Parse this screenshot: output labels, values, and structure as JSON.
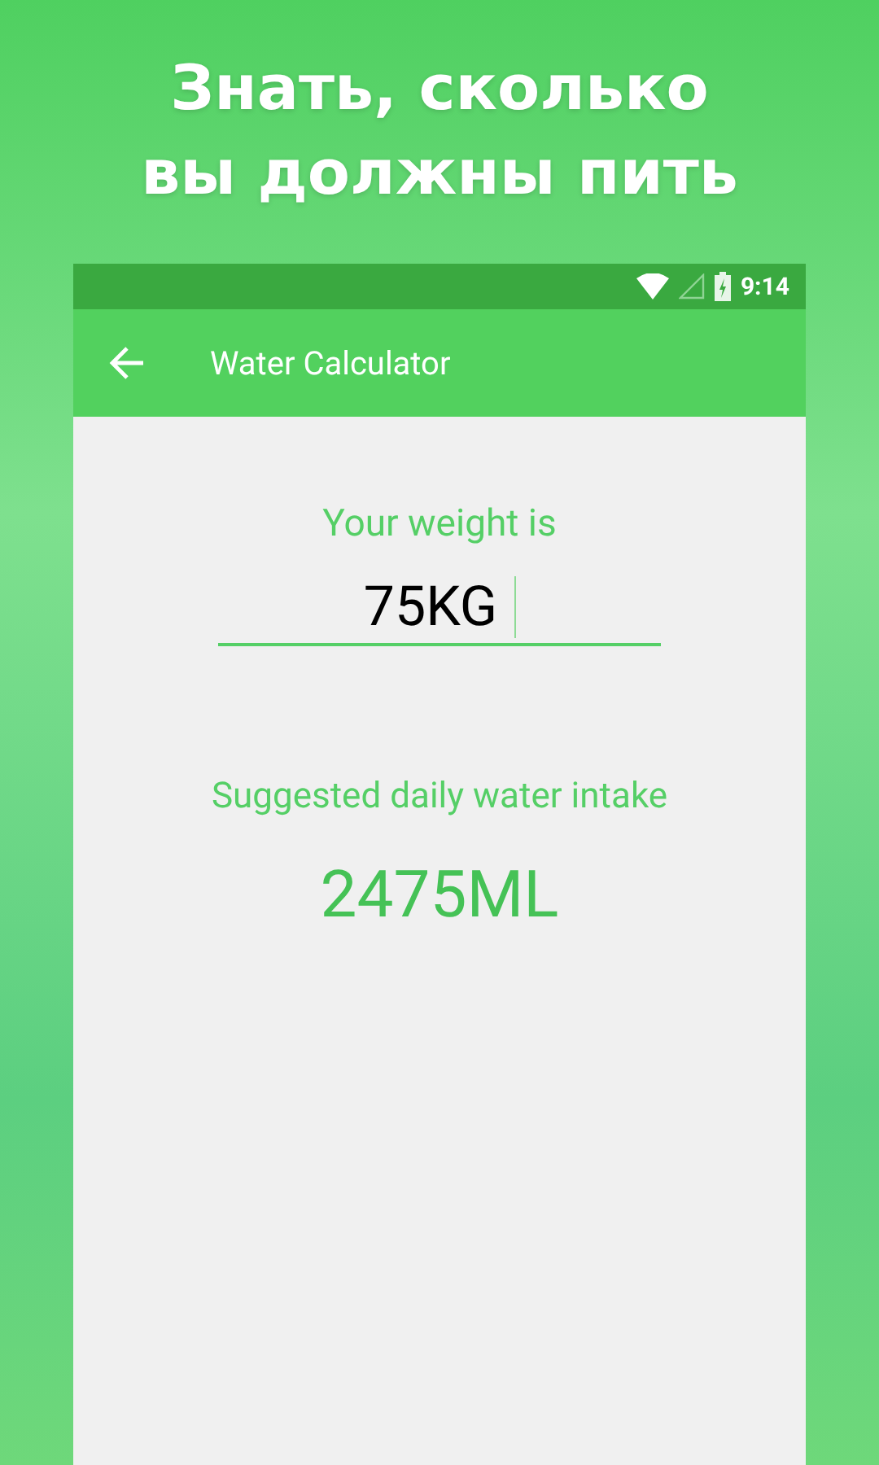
{
  "headline": [
    "Знать, сколько",
    "вы должны пить"
  ],
  "status_bar": {
    "time": "9:14"
  },
  "app_bar": {
    "title": "Water Calculator"
  },
  "weight": {
    "label": "Your weight is",
    "value": "75KG"
  },
  "result": {
    "label": "Suggested daily water intake",
    "value": "2475ML"
  }
}
